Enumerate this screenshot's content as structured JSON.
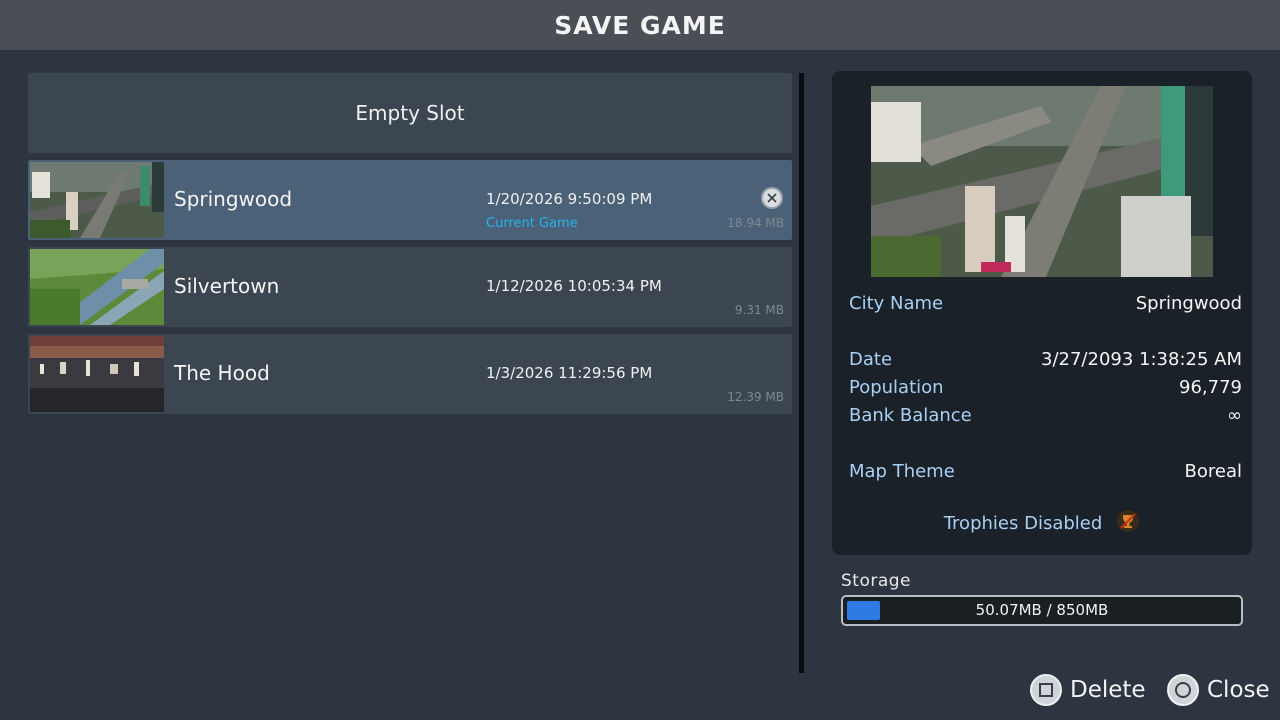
{
  "header": {
    "title": "SAVE GAME"
  },
  "save_list": {
    "empty_slot_label": "Empty Slot",
    "rows": [
      {
        "name": "Springwood",
        "date": "1/20/2026 9:50:09 PM",
        "status": "Current Game",
        "size": "18.94 MB",
        "selected": true
      },
      {
        "name": "Silvertown",
        "date": "1/12/2026 10:05:34 PM",
        "status": "",
        "size": "9.31 MB",
        "selected": false
      },
      {
        "name": "The Hood",
        "date": "1/3/2026 11:29:56 PM",
        "status": "",
        "size": "12.39 MB",
        "selected": false
      }
    ]
  },
  "details": {
    "city_name_label": "City Name",
    "city_name_value": "Springwood",
    "date_label": "Date",
    "date_value": "3/27/2093 1:38:25 AM",
    "population_label": "Population",
    "population_value": "96,779",
    "bank_balance_label": "Bank Balance",
    "bank_balance_value": "∞",
    "map_theme_label": "Map Theme",
    "map_theme_value": "Boreal",
    "trophies_label": "Trophies Disabled"
  },
  "storage": {
    "label": "Storage",
    "value_text": "50.07MB / 850MB",
    "used_fraction": 0.059
  },
  "footer": {
    "delete_label": "Delete",
    "close_label": "Close"
  },
  "icons": {
    "delete_button": "square-button-icon",
    "close_button": "circle-button-icon",
    "row_delete": "close-circle-icon",
    "trophy": "trophy-disabled-icon"
  },
  "colors": {
    "accent_blue": "#2f7be5",
    "current_game": "#2ab2ea",
    "selected_row": "#4a6178",
    "label_blue": "#a9cff3"
  }
}
